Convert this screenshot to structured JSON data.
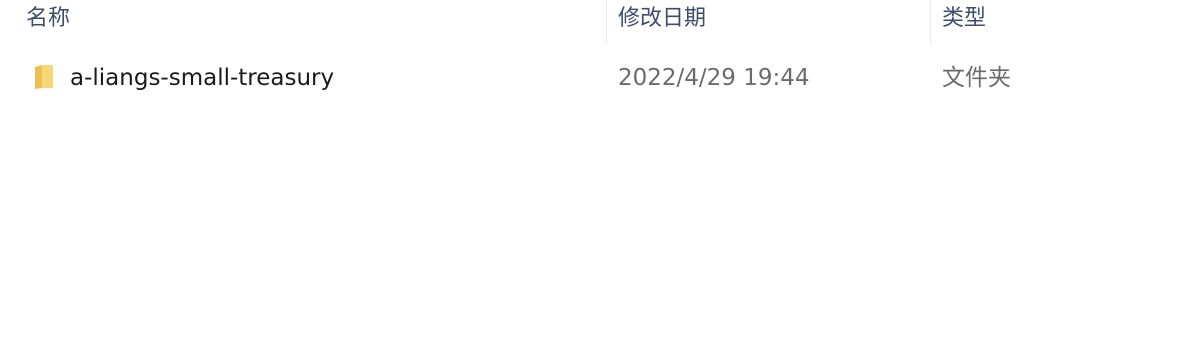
{
  "columns": {
    "name": "名称",
    "modified": "修改日期",
    "type": "类型"
  },
  "rows": [
    {
      "icon": "folder-icon",
      "name": "a-liangs-small-treasury",
      "modified": "2022/4/29 19:44",
      "type": "文件夹"
    }
  ],
  "colors": {
    "header_text": "#3f4d6b",
    "name_text": "#1a1a1a",
    "meta_text": "#6b6b6b",
    "folder_light": "#f8d775",
    "folder_dark": "#e8b84a"
  }
}
